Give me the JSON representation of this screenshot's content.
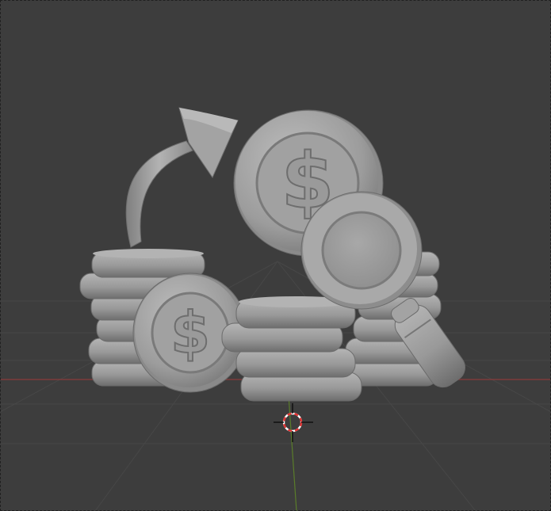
{
  "viewport": {
    "background_color": "#3d3d3d",
    "grid_line_color": "#4a4a4a",
    "x_axis_color": "#8a3b3b",
    "y_axis_color": "#5a7d2a",
    "frame_border": "dashed",
    "frame_border_color": "#202020"
  },
  "scene": {
    "model_color": "#9a9a9a",
    "objects": [
      {
        "name": "curved-arrow",
        "type": "arrow"
      },
      {
        "name": "coin-stack-left",
        "type": "coin-stack"
      },
      {
        "name": "coin-stack-right",
        "type": "coin-stack"
      },
      {
        "name": "coin-stack-center",
        "type": "coin-stack"
      },
      {
        "name": "dollar-coin-large",
        "type": "coin",
        "symbol": "$"
      },
      {
        "name": "dollar-coin-small",
        "type": "coin",
        "symbol": "$"
      },
      {
        "name": "magnifying-glass",
        "type": "magnifier"
      }
    ]
  },
  "cursor_3d": {
    "icon": "3d-cursor-icon",
    "colors": [
      "#e03030",
      "#ffffff",
      "#101010"
    ]
  }
}
